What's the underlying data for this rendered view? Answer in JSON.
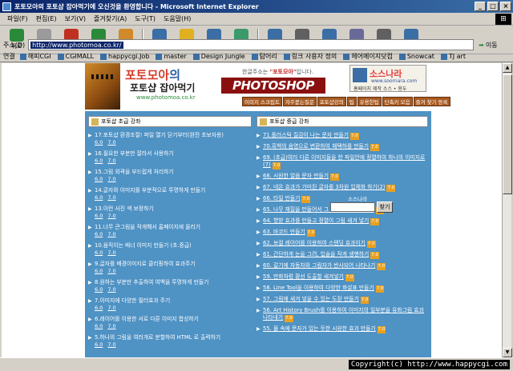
{
  "window": {
    "title": "포토모아의 포토샵 잡아먹기에 오신것을 환영합니다 - Microsoft Internet Explorer",
    "controls": [
      "_",
      "□",
      "×"
    ]
  },
  "menu": [
    "파일(F)",
    "편집(E)",
    "보기(V)",
    "즐겨찾기(A)",
    "도구(T)",
    "도움말(H)"
  ],
  "toolbar": {
    "buttons": [
      {
        "label": "뒤로",
        "icon": "back-arrow-icon",
        "color": "#2a8a3a"
      },
      {
        "label": "앞으로",
        "icon": "forward-arrow-icon",
        "color": "#9a9a9a",
        "disabled": true
      },
      {
        "label": "중지",
        "icon": "stop-icon",
        "color": "#c03020"
      },
      {
        "label": "새로고침",
        "icon": "refresh-icon",
        "color": "#2a8a3a"
      },
      {
        "label": "홈",
        "icon": "home-icon",
        "color": "#d08a2a"
      },
      {
        "label": "검색",
        "icon": "search-icon",
        "color": "#3a6ea5"
      },
      {
        "label": "즐겨찾기",
        "icon": "favorites-icon",
        "color": "#e0b020"
      },
      {
        "label": "미디어",
        "icon": "media-icon",
        "color": "#3a6ea5"
      },
      {
        "label": "기록",
        "icon": "history-icon",
        "color": "#3a9a6a"
      },
      {
        "label": "메일",
        "icon": "mail-icon",
        "color": "#3a6ea5"
      },
      {
        "label": "인쇄",
        "icon": "print-icon",
        "color": "#606060"
      },
      {
        "label": "편집",
        "icon": "edit-icon",
        "color": "#3a6ea5"
      },
      {
        "label": "토론",
        "icon": "discuss-icon",
        "color": "#6a6a9a"
      },
      {
        "label": "프린트",
        "icon": "printer-icon",
        "color": "#606060"
      },
      {
        "label": "새창",
        "icon": "new-window-icon",
        "color": "#3a6ea5"
      }
    ]
  },
  "address": {
    "label": "주소(D)",
    "url": "http://www.photomoa.co.kr/",
    "go_label": "이동"
  },
  "links": {
    "label": "연결",
    "items": [
      "해피CGI",
      "CGIMALL",
      "happycgi.Job",
      "master",
      "Design Jungle",
      "탐어리",
      "링크 사용자 정의",
      "헤어메이지닷컴",
      "Snowcat",
      "TJ art"
    ]
  },
  "banner": {
    "logo_line1": "포토모아",
    "logo_line1_suffix": "의",
    "logo_line2": "포토샵 잡아먹기",
    "logo_url": "www.photomoa.co.kr",
    "tagline_prefix": "한글주소는 ",
    "tagline_bold": "\"포토모아\"",
    "tagline_suffix": "입니다.",
    "photoshop_text": "PHOTOSHOP",
    "sosnara_title": "소스나라",
    "sosnara_url": "www.soornara.com",
    "sosnara_sub": "홈페이지 제작 소스 • 용두",
    "nav": [
      "이미지 스크립트",
      "자주묻는질문",
      "포토샵강의",
      "팁",
      "유용한팁",
      "단축키 모음",
      "즐겨 찾기 등록"
    ]
  },
  "left_column": {
    "header": "포토샵 초급 강좌",
    "items": [
      {
        "title": "17.포토샵 환경조절! 파일 열기 닫기부터(완전 초보자용)",
        "versions": [
          "6.0",
          "7.0"
        ]
      },
      {
        "title": "16.필요한 부분만 잘라서 사용하기",
        "versions": [
          "6.0",
          "7.0"
        ]
      },
      {
        "title": "15.그림 외곽을 부드럽게 처리하기",
        "versions": [
          "6.0",
          "7.0"
        ]
      },
      {
        "title": "14.글자와 이미지를 부분적으로 투명하게 만들기",
        "versions": [
          "6.0",
          "7.0"
        ]
      },
      {
        "title": "13.이런 사진 색 보정하기",
        "versions": [
          "6.0",
          "7.0"
        ]
      },
      {
        "title": "11.너무 큰그림을 작게해서 홈페이지에 올리기",
        "versions": [
          "6.0",
          "7.0"
        ]
      },
      {
        "title": "10.움직이는 배너 이미지 만들기 (초.중급)",
        "versions": [
          "6.0",
          "7.0"
        ]
      },
      {
        "title": "9.글자를 배경이미지로 클리핑하여 효과주기",
        "versions": [
          "6.0",
          "7.0"
        ]
      },
      {
        "title": "8.원하는 부분만 추출하여 여백을 투명하게 만들기",
        "versions": [
          "6.0",
          "7.0"
        ]
      },
      {
        "title": "7.이미지에 다양한 필터효과 주기",
        "versions": [
          "6.0",
          "7.0"
        ]
      },
      {
        "title": "6.레이어를 이용한 서로 다른 이미지 합성하기",
        "versions": [
          "6.0",
          "7.0"
        ]
      },
      {
        "title": "5.하나의 그림을 여러개로 분할하여 HTML 로 출력하기",
        "versions": [
          "6.0",
          "7.0"
        ]
      }
    ]
  },
  "right_column": {
    "header": "포토샵 중급 강좌",
    "star_label": "7.0",
    "items": [
      "71.틀러스틱 질감이 나는 문자 만들기",
      "70.흑백의 음영으로 변환하여 채택하를 만들기",
      "69. (초급)여러 다른 이미지들을 한 파일안에 정렬하여 하나의 이미지로(7)",
      "68. 시원한 얼음 문자 만들기",
      "67. 네온 효과가 가미된 글자를 3차원 입체화 하기(2)",
      "66. 타일 만들기",
      "65. 나무 재질을 만들어서 그 위에 음양을 새기기",
      "64. 향받 효과를 만들고 정렬이 그림 새겨 넣기",
      "63. 바코드 만들기",
      "62. 보컬 레이어를 이용하여 스탠딩 효과이기",
      "61. 간단하게 눈을 그려, 입술을 작게 생행하기",
      "60. 갈기에 자동차와 그림자가 반사되어 나타나기",
      "59. 만화처럼 황선 도출할 새겨넣기",
      "58. Line Tool을 이용하여 다양한 화살표 만들기",
      "57. 그림에 새겨 넣을 수 있는 도장 만들기",
      "56. Art History Brush를 이용하여 이미지의 일부분을 유화그림 효과 나타내기",
      "55. 물 속에 문자가 있는 듯한 시원한 효과 만들기"
    ]
  },
  "search": {
    "brand": "소스나라",
    "button_label": "찾기"
  },
  "copyright": "Copyright(c) http://www.happycgi.com"
}
